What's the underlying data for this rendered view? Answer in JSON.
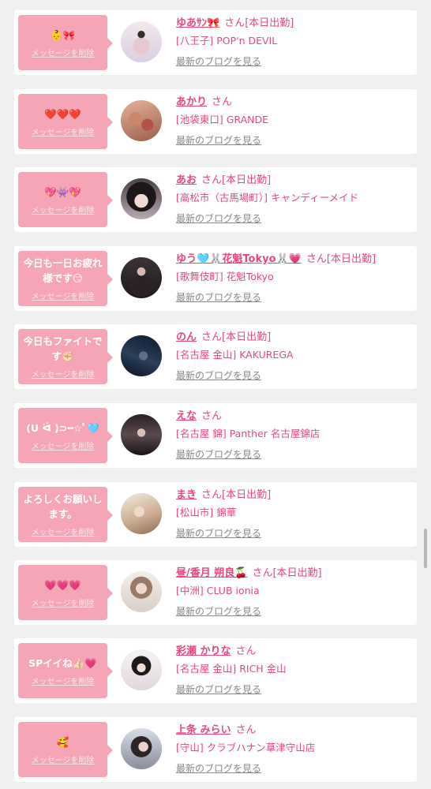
{
  "delete_label": "メッセージを削除",
  "san_label": "さん",
  "blog_label": "最新のブログを見る",
  "colors": {
    "accent": "#e8487a",
    "bubble": "#f6a5b6",
    "card": "#ffffff",
    "background": "#efefef"
  },
  "entries": [
    {
      "message": "👶🎀",
      "name": "ゆあｻﾝ🎀",
      "shift": "[本日出勤]",
      "shop": "[八王子] POP'n DEVIL"
    },
    {
      "message": "❤️❤️❤️",
      "name": "あかり",
      "shift": "",
      "shop": "[池袋東口] GRANDE"
    },
    {
      "message": "💖👾💖",
      "name": "あお",
      "shift": "[本日出勤]",
      "shop": "[高松市（古馬場町）] キャンディーメイド"
    },
    {
      "message": "今日も一日お疲れ様です😏",
      "name": "ゆう🩵🐰花魁Tokyo🐰💗",
      "shift": "[本日出勤]",
      "shop": "[歌舞伎町] 花魁Tokyo"
    },
    {
      "message": "今日もファイトです✊🏻",
      "name": "のん",
      "shift": "[本日出勤]",
      "shop": "[名古屋 金山] KAKUREGA"
    },
    {
      "message": "(U ᐛ )⊃━☆ﾟ🩵",
      "name": "えな",
      "shift": "",
      "shop": "[名古屋 錦] Panther 名古屋錦店"
    },
    {
      "message": "よろしくお願いします。",
      "name": "まき",
      "shift": "[本日出勤]",
      "shop": "[松山市] 錦華"
    },
    {
      "message": "💗💗💗",
      "name": "昼/香月 朔良🍒",
      "shift": "[本日出勤]",
      "shop": "[中洲] CLUB ionia"
    },
    {
      "message": "SPイイね👍🏻💗",
      "name": "彩瀬 かりな",
      "shift": "",
      "shop": "[名古屋 金山] RICH 金山"
    },
    {
      "message": "🥰",
      "name": "上条 みらい",
      "shift": "",
      "shop": "[守山] クラブハナン草津守山店"
    }
  ]
}
